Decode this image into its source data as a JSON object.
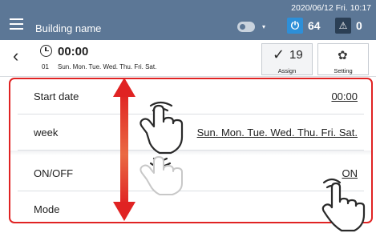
{
  "topbar": {
    "building_name": "Building name",
    "datetime": "2020/06/12 Fri. 10:17",
    "power_count": "64",
    "alert_count": "0",
    "menu_icon": "hamburger-menu-icon",
    "power_icon": "power-icon",
    "alert_icon": "warning-icon"
  },
  "header": {
    "time": "00:00",
    "number": "01",
    "days": "Sun. Mon. Tue. Wed. Thu. Fri. Sat.",
    "assign_count": "19",
    "assign_label": "Assign",
    "setting_label": "Setting"
  },
  "rows": [
    {
      "label": "Start date",
      "value": "00:00"
    },
    {
      "label": "week",
      "value": "Sun. Mon. Tue. Wed. Thu. Fri. Sat."
    },
    {
      "label": "ON/OFF",
      "value": "ON"
    },
    {
      "label": "Mode",
      "value": ""
    }
  ],
  "colors": {
    "topbar": "#5c7796",
    "accent_red": "#e02323",
    "power": "#2d8fd8",
    "alert": "#2b3f55"
  }
}
